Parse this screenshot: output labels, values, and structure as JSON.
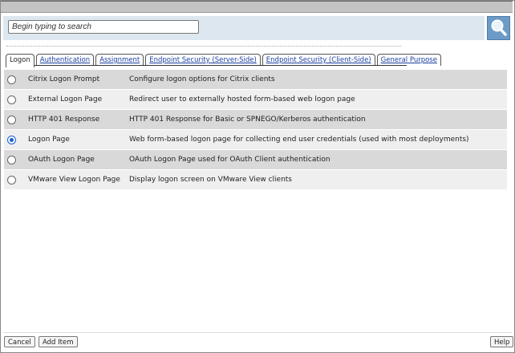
{
  "search": {
    "placeholder": "Begin typing to search"
  },
  "tabs": [
    {
      "label": "Logon",
      "active": true
    },
    {
      "label": "Authentication"
    },
    {
      "label": "Assignment"
    },
    {
      "label": "Endpoint Security (Server-Side)"
    },
    {
      "label": "Endpoint Security (Client-Side)"
    },
    {
      "label": "General Purpose"
    }
  ],
  "items": [
    {
      "name": "Citrix Logon Prompt",
      "description": "Configure logon options for Citrix clients",
      "selected": false
    },
    {
      "name": "External Logon Page",
      "description": "Redirect user to externally hosted form-based web logon page",
      "selected": false
    },
    {
      "name": "HTTP 401 Response",
      "description": "HTTP 401 Response for Basic or SPNEGO/Kerberos authentication",
      "selected": false
    },
    {
      "name": "Logon Page",
      "description": "Web form-based logon page for collecting end user credentials (used with most deployments)",
      "selected": true
    },
    {
      "name": "OAuth Logon Page",
      "description": "OAuth Logon Page used for OAuth Client authentication",
      "selected": false
    },
    {
      "name": "VMware View Logon Page",
      "description": "Display logon screen on VMware View clients",
      "selected": false
    }
  ],
  "footer": {
    "cancel": "Cancel",
    "add_item": "Add Item",
    "help": "Help"
  },
  "colors": {
    "accent": "#6d9bc8",
    "search_bg": "#dde7f0"
  }
}
